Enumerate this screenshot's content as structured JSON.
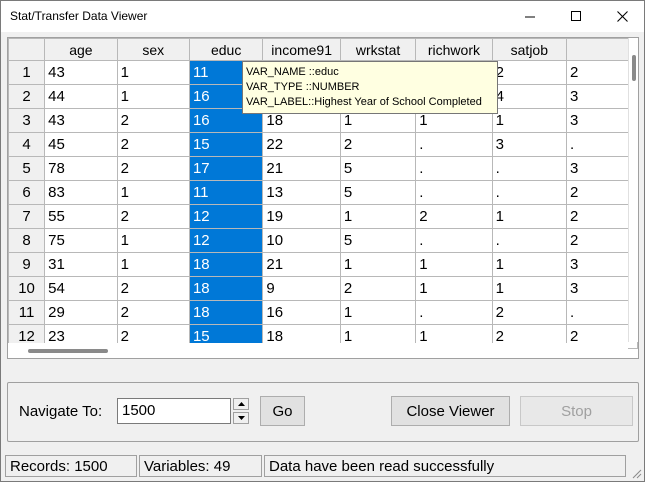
{
  "window": {
    "title": "Stat/Transfer Data Viewer"
  },
  "grid": {
    "columns": [
      "age",
      "sex",
      "educ",
      "income91",
      "wrkstat",
      "richwork",
      "satjob",
      ""
    ],
    "rows": [
      {
        "num": "1",
        "cells": [
          "43",
          "1",
          "11",
          "",
          "",
          "",
          "2",
          "2"
        ]
      },
      {
        "num": "2",
        "cells": [
          "44",
          "1",
          "16",
          "",
          "",
          "",
          "4",
          "3"
        ]
      },
      {
        "num": "3",
        "cells": [
          "43",
          "2",
          "16",
          "18",
          "1",
          "1",
          "1",
          "3"
        ]
      },
      {
        "num": "4",
        "cells": [
          "45",
          "2",
          "15",
          "22",
          "2",
          ".",
          "3",
          "."
        ]
      },
      {
        "num": "5",
        "cells": [
          "78",
          "2",
          "17",
          "21",
          "5",
          ".",
          ".",
          "3"
        ]
      },
      {
        "num": "6",
        "cells": [
          "83",
          "1",
          "11",
          "13",
          "5",
          ".",
          ".",
          "2"
        ]
      },
      {
        "num": "7",
        "cells": [
          "55",
          "2",
          "12",
          "19",
          "1",
          "2",
          "1",
          "2"
        ]
      },
      {
        "num": "8",
        "cells": [
          "75",
          "1",
          "12",
          "10",
          "5",
          ".",
          ".",
          "2"
        ]
      },
      {
        "num": "9",
        "cells": [
          "31",
          "1",
          "18",
          "21",
          "1",
          "1",
          "1",
          "3"
        ]
      },
      {
        "num": "10",
        "cells": [
          "54",
          "2",
          "18",
          "9",
          "2",
          "1",
          "1",
          "3"
        ]
      },
      {
        "num": "11",
        "cells": [
          "29",
          "2",
          "18",
          "16",
          "1",
          ".",
          "2",
          "."
        ]
      },
      {
        "num": "12",
        "cells": [
          "23",
          "2",
          "15",
          "18",
          "1",
          "1",
          "2",
          "2"
        ]
      }
    ]
  },
  "tooltip": {
    "line1": "VAR_NAME ::educ",
    "line2": "VAR_TYPE ::NUMBER",
    "line3": "VAR_LABEL::Highest Year of School Completed"
  },
  "nav": {
    "label": "Navigate To:",
    "value": "1500",
    "go": "Go",
    "close": "Close Viewer",
    "stop": "Stop"
  },
  "status": {
    "records": "Records: 1500",
    "variables": "Variables: 49",
    "message": "Data have been read successfully"
  },
  "colors": {
    "selection": "#0078d7",
    "tooltip_bg": "#ffffe1"
  }
}
